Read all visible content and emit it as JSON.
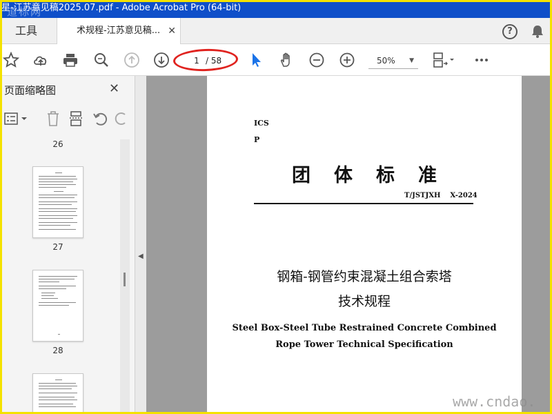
{
  "window": {
    "title": "星-江苏意见稿2025.07.pdf - Adobe Acrobat Pro (64-bit)",
    "watermark_top": "道标网"
  },
  "tabs": {
    "tools_label": "工具",
    "document_label": "术规程-江苏意见稿...",
    "close_glyph": "✕"
  },
  "toolbar": {
    "current_page": "1",
    "total_pages": "/ 58",
    "zoom": "50%",
    "icons": [
      "star-icon",
      "upload-icon",
      "print-icon",
      "find-icon",
      "page-up-icon",
      "page-down-icon",
      "select-arrow-icon",
      "hand-icon",
      "zoom-out-icon",
      "zoom-in-icon",
      "page-display-icon",
      "more-icon"
    ]
  },
  "thumbnail_pane": {
    "title": "页面缩略图",
    "close_glyph": "✕",
    "pages": [
      {
        "number": "26"
      },
      {
        "number": "27"
      },
      {
        "number": "28"
      }
    ]
  },
  "document": {
    "ics": "ICS",
    "class_code": "P",
    "standard_type": "团体标准",
    "standard_code": "T/JSTJXH    X-2024",
    "title_cn_line1": "钢箱-钢管约束混凝土组合索塔",
    "title_cn_line2": "技术规程",
    "title_en_line1": "Steel Box-Steel Tube Restrained Concrete Combined",
    "title_en_line2": "Rope Tower Technical Specification"
  },
  "watermark_bottom": "www.cndao.",
  "colors": {
    "titlebar": "#0f4fc9",
    "frame": "#f4e200",
    "highlight": "#e0231f",
    "accent_blue": "#1a73e8"
  }
}
